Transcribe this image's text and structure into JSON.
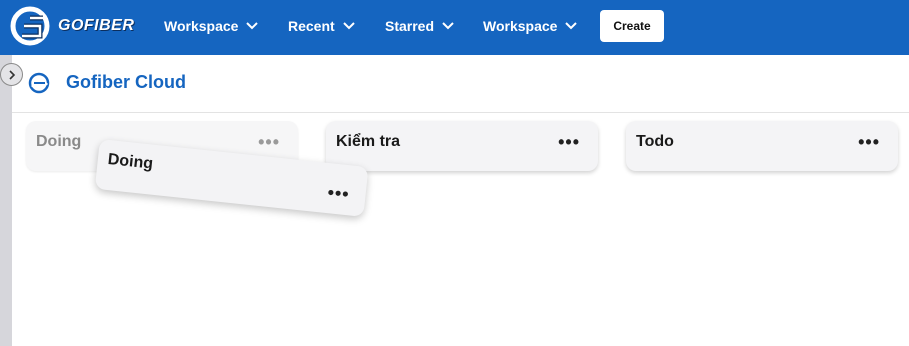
{
  "brand": {
    "name": "GOFIBER",
    "primary": "#1565c0"
  },
  "nav": [
    {
      "label": "Workspace"
    },
    {
      "label": "Recent"
    },
    {
      "label": "Starred"
    },
    {
      "label": "Workspace"
    }
  ],
  "create_label": "Create",
  "board": {
    "title": "Gofiber Cloud"
  },
  "columns": [
    {
      "title": "Doing",
      "state": "placeholder"
    },
    {
      "title": "Kiểm tra"
    },
    {
      "title": "Todo"
    }
  ],
  "dragging_card": {
    "title": "Doing"
  },
  "menu_dots": "•••"
}
